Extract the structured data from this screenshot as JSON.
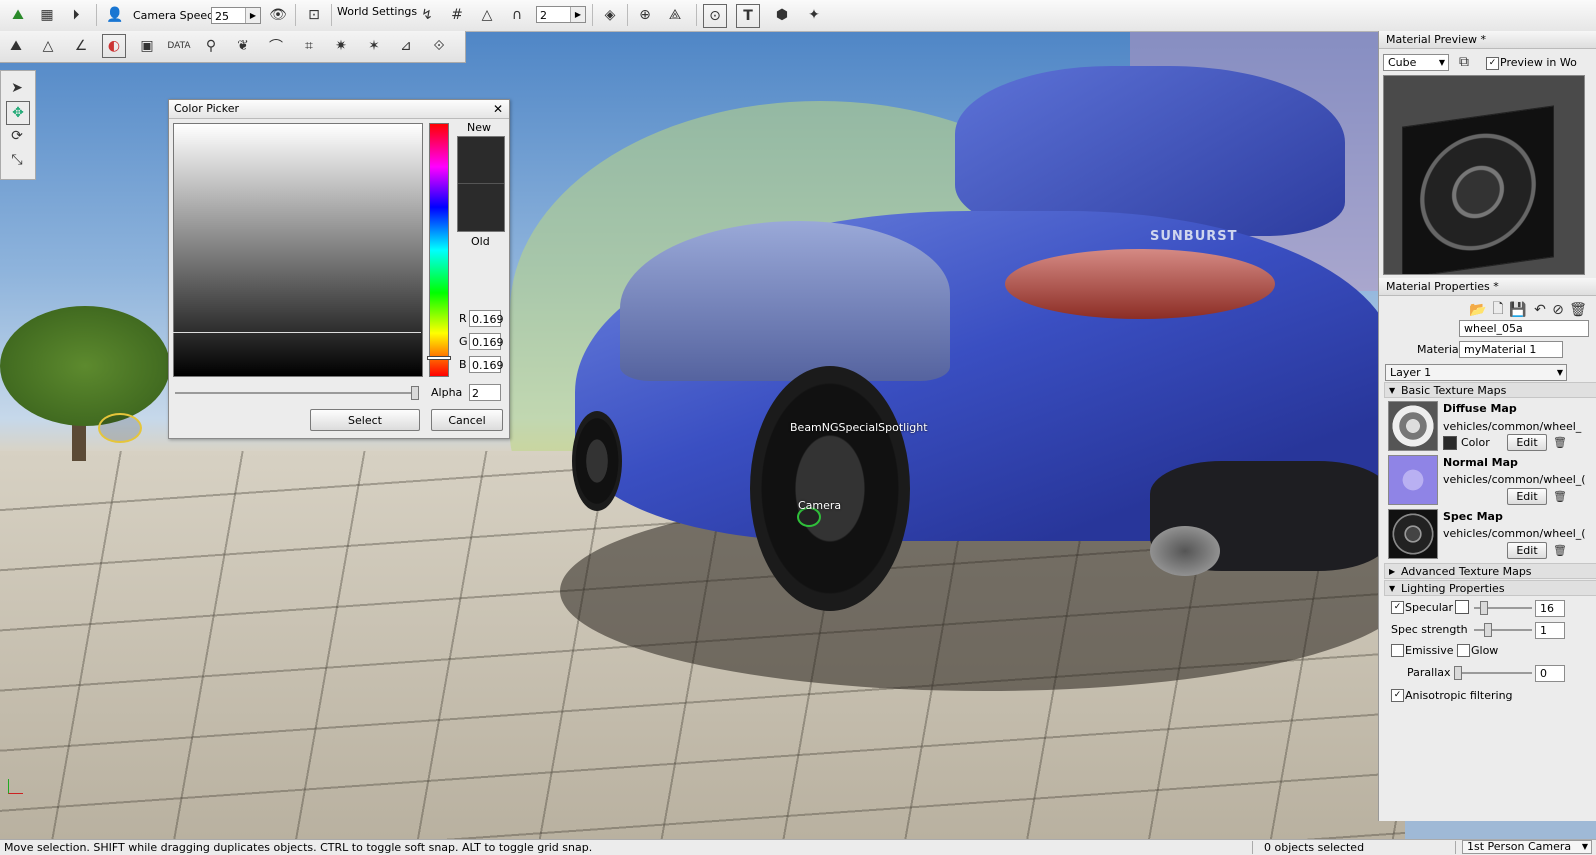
{
  "toolbar": {
    "camera_speed_label": "Camera Speed",
    "camera_speed_value": "25",
    "world_settings_label": "World Settings",
    "grid_value": "2"
  },
  "viewport": {
    "car_badge": "SUNBURST",
    "spotlight_label": "BeamNGSpecialSpotlight",
    "camera_label": "Camera"
  },
  "color_picker": {
    "title": "Color Picker",
    "new_label": "New",
    "old_label": "Old",
    "r_label": "R",
    "r_value": "0.169",
    "g_label": "G",
    "g_value": "0.169",
    "b_label": "B",
    "b_value": "0.169",
    "alpha_label": "Alpha",
    "alpha_value": "2",
    "select_label": "Select",
    "cancel_label": "Cancel",
    "current_color": "#2b2b2b"
  },
  "material_preview": {
    "title": "Material Preview *",
    "shape_value": "Cube",
    "preview_in_world_label": "Preview in Wo"
  },
  "material_properties": {
    "title": "Material Properties *",
    "name_value": "wheel_05a",
    "material_label": "Material",
    "material_value": "myMaterial 1",
    "layer_value": "Layer 1",
    "basic_texture_maps": "Basic Texture Maps",
    "diffuse_title": "Diffuse Map",
    "diffuse_path": "vehicles/common/wheel_",
    "color_label": "Color",
    "edit_label": "Edit",
    "normal_title": "Normal Map",
    "normal_path": "vehicles/common/wheel_(",
    "spec_title": "Spec Map",
    "spec_path": "vehicles/common/wheel_(",
    "advanced_texture_maps": "Advanced Texture Maps",
    "lighting_properties": "Lighting Properties",
    "specular_label": "Specular",
    "specular_value": "16",
    "spec_strength_label": "Spec strength",
    "spec_strength_value": "1",
    "emissive_label": "Emissive",
    "glow_label": "Glow",
    "parallax_label": "Parallax",
    "parallax_value": "0",
    "anisotropic_label": "Anisotropic filtering"
  },
  "status": {
    "hint": "Move selection.  SHIFT while dragging duplicates objects.  CTRL to toggle soft snap.  ALT to toggle grid snap.",
    "selection": "0 objects selected",
    "camera_mode": "1st Person Camera"
  }
}
